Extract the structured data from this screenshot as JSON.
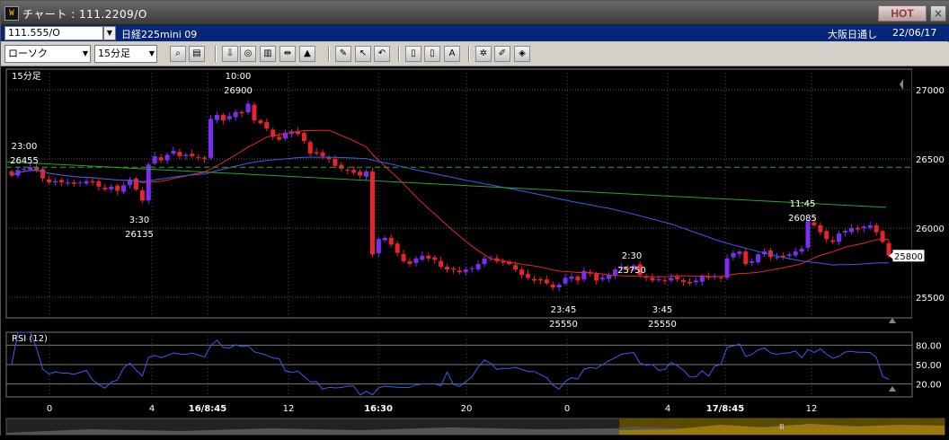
{
  "window": {
    "title": "チャート : 111.2209/O",
    "hot_label": "HOT",
    "close_label": "×",
    "app_icon": "chart-app-icon"
  },
  "infobar": {
    "code": "111.555/O",
    "symbol": "日経225mini 09",
    "market": "大阪日通し",
    "date": "22/06/17"
  },
  "toolbar": {
    "chart_type": "ローソク",
    "interval": "15分足",
    "buttons": [
      "zoom-icon",
      "layout-icon",
      "download-icon",
      "compare-icon",
      "indicator-icon",
      "split-icon",
      "drawing-disabled-icon",
      "pencil-icon",
      "cursor-icon",
      "undo-icon",
      "candle-icon",
      "candle-compare-icon",
      "all-icon",
      "settings-icon",
      "paint-icon",
      "color-icon"
    ]
  },
  "chart_data": {
    "type": "candlestick",
    "panel_label": "15分足",
    "ylim": [
      25350,
      27150
    ],
    "y_ticks": [
      "27000",
      "26500",
      "26000",
      "25500"
    ],
    "current_price": "25800",
    "annotations": [
      {
        "time": "23:00",
        "price": "26455"
      },
      {
        "time": "10:00",
        "price": "26900"
      },
      {
        "time": "3:30",
        "price": "26135"
      },
      {
        "time": "2:30",
        "price": "25750"
      },
      {
        "time": "11:45",
        "price": "26085"
      },
      {
        "time": "23:45",
        "price": "25550"
      },
      {
        "time": "3:45",
        "price": "25550"
      }
    ],
    "x_ticks": [
      "0",
      "4",
      "16/8:45",
      "12",
      "16:30",
      "20",
      "0",
      "4",
      "17/8:45",
      "12"
    ],
    "closes": [
      26380,
      26420,
      26430,
      26440,
      26420,
      26360,
      26330,
      26340,
      26330,
      26330,
      26320,
      26330,
      26340,
      26330,
      26300,
      26280,
      26300,
      26270,
      26310,
      26350,
      26280,
      26200,
      26460,
      26520,
      26490,
      26530,
      26560,
      26520,
      26530,
      26520,
      26510,
      26500,
      26790,
      26820,
      26780,
      26810,
      26840,
      26830,
      26900,
      26780,
      26760,
      26720,
      26660,
      26640,
      26690,
      26700,
      26680,
      26630,
      26540,
      26540,
      26520,
      26500,
      26450,
      26430,
      26420,
      26400,
      26380,
      26410,
      25810,
      25920,
      25930,
      25880,
      25820,
      25760,
      25740,
      25780,
      25800,
      25780,
      25770,
      25720,
      25700,
      25700,
      25680,
      25700,
      25710,
      25740,
      25780,
      25790,
      25760,
      25750,
      25740,
      25700,
      25660,
      25640,
      25620,
      25620,
      25600,
      25570,
      25590,
      25640,
      25650,
      25620,
      25690,
      25670,
      25620,
      25640,
      25660,
      25700,
      25720,
      25700,
      25730,
      25660,
      25640,
      25620,
      25630,
      25620,
      25640,
      25630,
      25610,
      25600,
      25620,
      25650,
      25640,
      25650,
      25640,
      25780,
      25820,
      25830,
      25740,
      25760,
      25810,
      25830,
      25790,
      25790,
      25790,
      25810,
      25830,
      25850,
      26050,
      26020,
      25970,
      25920,
      25900,
      25960,
      25980,
      26000,
      25990,
      26010,
      26020,
      25970,
      25900,
      25800
    ],
    "rsi": {
      "label": "RSI (12)",
      "levels": [
        "80.00",
        "50.00",
        "20.00"
      ],
      "range": [
        0,
        100
      ]
    }
  }
}
